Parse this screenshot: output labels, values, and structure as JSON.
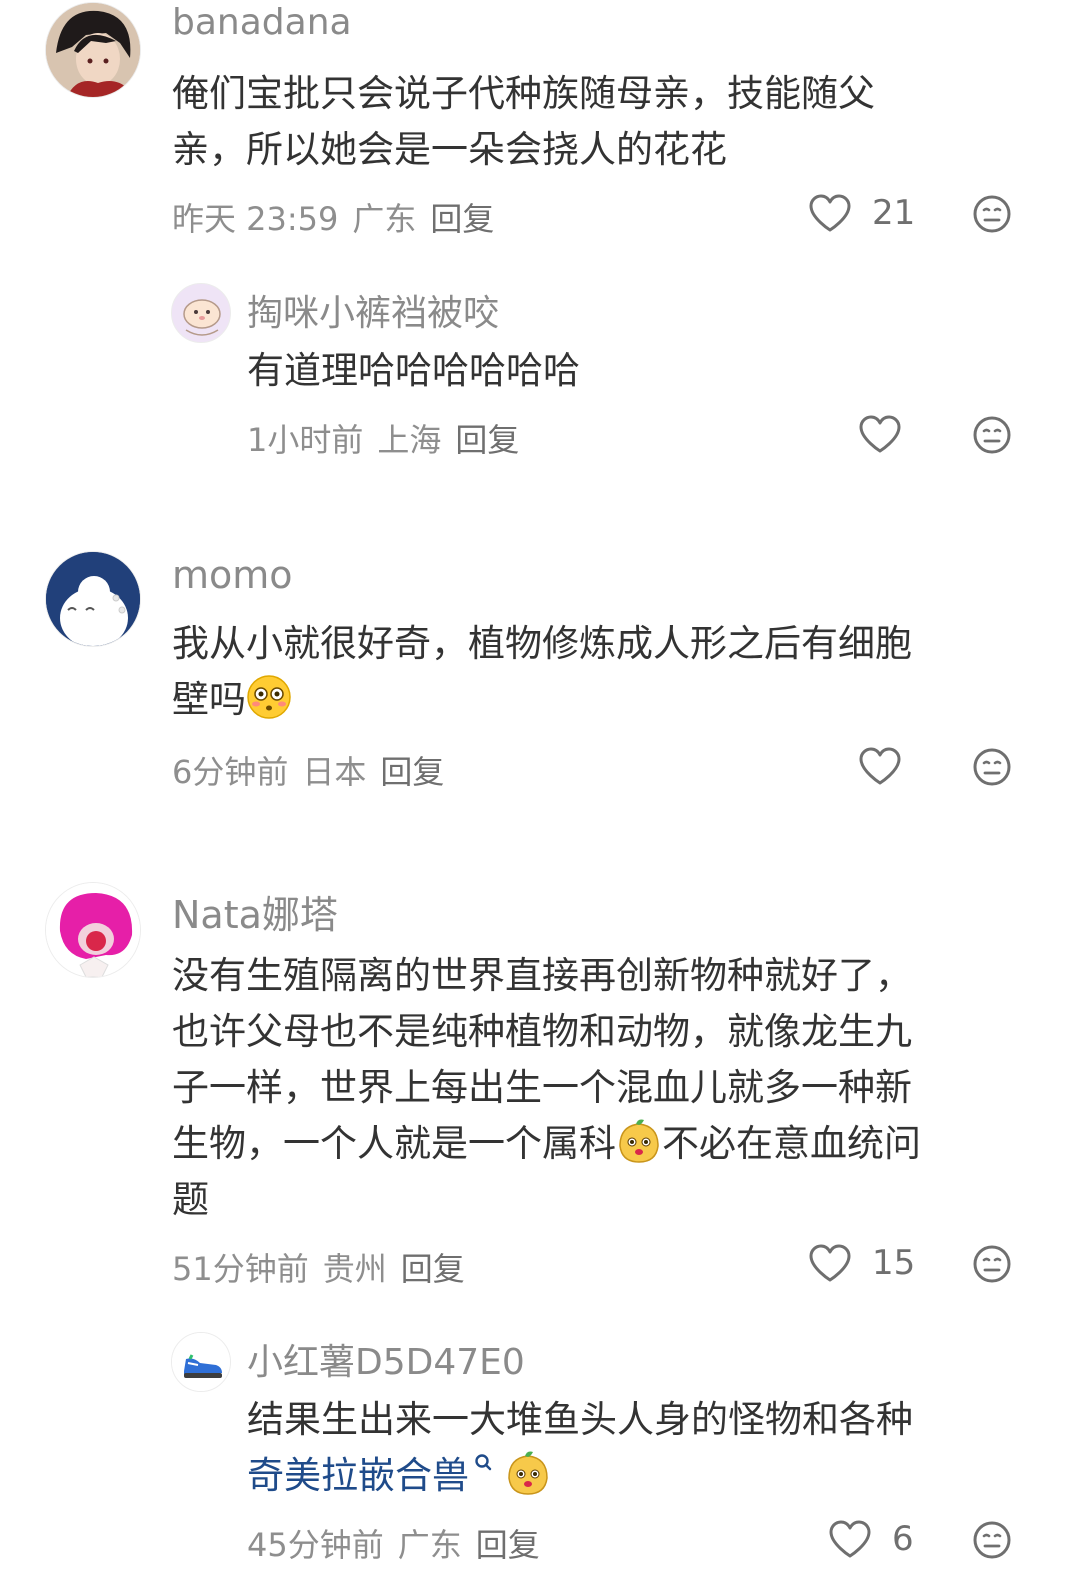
{
  "comments": [
    {
      "username": "banadana",
      "text_line1": "俺们宝批只会说子代种族随母亲，技能随父",
      "text_line2": "亲，所以她会是一朵会挠人的花花",
      "time": "昨天 23:59",
      "location": "广东",
      "reply_label": "回复",
      "likes": "21",
      "replies": [
        {
          "username": "掏咪小裤裆被咬",
          "text_line1": "有道理哈哈哈哈哈哈",
          "time": "1小时前",
          "location": "上海",
          "reply_label": "回复"
        }
      ]
    },
    {
      "username": "momo",
      "text_line1": "我从小就很好奇，植物修炼成人形之后有细胞",
      "text_line2": "壁吗",
      "emoji": "flushed-face-emoji",
      "time": "6分钟前",
      "location": "日本",
      "reply_label": "回复"
    },
    {
      "username": "Nata娜塔",
      "text_line1": "没有生殖隔离的世界直接再创新物种就好了，",
      "text_line2": "也许父母也不是纯种植物和动物，就像龙生九",
      "text_line3": "子一样，世界上每出生一个混血儿就多一种新",
      "text_line4a": "生物，一个人就是一个属科",
      "text_line4b": "不必在意血统问",
      "text_line5": "题",
      "emoji": "sticker-emoji",
      "time": "51分钟前",
      "location": "贵州",
      "reply_label": "回复",
      "likes": "15",
      "replies": [
        {
          "username": "小红薯D5D47E0",
          "text_line1": "结果生出来一大堆鱼头人身的怪物和各种",
          "link_text": "奇美拉嵌合兽",
          "time": "45分钟前",
          "location": "广东",
          "reply_label": "回复",
          "likes": "6"
        }
      ]
    }
  ],
  "colors": {
    "username": "#8a8a8a",
    "text": "#333333",
    "meta": "#8e8e8e",
    "link": "#1f4b8a"
  }
}
